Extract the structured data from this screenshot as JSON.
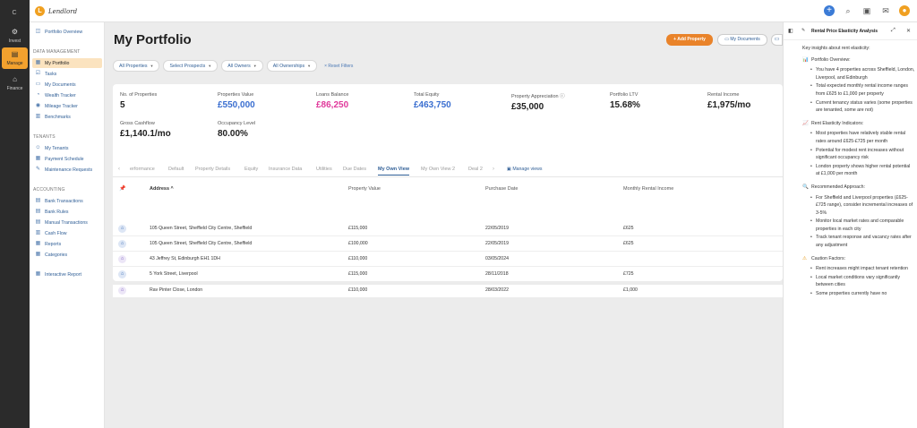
{
  "rail": {
    "collapse": "C",
    "items": [
      {
        "label": "Invest",
        "icon": "invest-icon"
      },
      {
        "label": "Manage",
        "icon": "manage-icon"
      },
      {
        "label": "Finance",
        "icon": "finance-icon"
      }
    ]
  },
  "topbar": {
    "logo_letter": "L",
    "app_name": "Lendlord",
    "icons": [
      "plus-icon",
      "search-icon",
      "camera-icon",
      "gift-icon",
      "avatar-icon"
    ]
  },
  "nav": {
    "overview": "Portfolio Overview",
    "data_heading": "DATA MANAGEMENT",
    "data_items": [
      "My Portfolio",
      "Tasks",
      "My Documents",
      "Wealth Tracker",
      "Mileage Tracker",
      "Benchmarks"
    ],
    "tenants_heading": "TENANTS",
    "tenant_items": [
      "My Tenants",
      "Payment Schedule",
      "Maintenance Requests"
    ],
    "accounting_heading": "ACCOUNTING",
    "accounting_items": [
      "Bank Transactions",
      "Bank Rules",
      "Manual Transactions",
      "Cash Flow",
      "Reports",
      "Categories"
    ],
    "interactive_report": "Interactive Report"
  },
  "main": {
    "title": "My Portfolio",
    "add_property": "+ Add Property",
    "my_documents": "My Documents",
    "filters": [
      "All Properties",
      "Select Prospects",
      "All Owners",
      "All Ownerships"
    ],
    "reset": "× Reset Filters"
  },
  "stats": [
    {
      "label": "No. of Properties",
      "value": "5",
      "color": "#1e1e1e"
    },
    {
      "label": "Properties Value",
      "value": "£550,000",
      "color": "#3b6fd0"
    },
    {
      "label": "Loans Balance",
      "value": "£86,250",
      "color": "#e0399b"
    },
    {
      "label": "Total Equity",
      "value": "£463,750",
      "color": "#3b6fd0"
    },
    {
      "label": "Property Appreciation ⓘ",
      "value": "£35,000",
      "color": "#1e1e1e"
    },
    {
      "label": "Portfolio LTV",
      "value": "15.68%",
      "color": "#1e1e1e"
    },
    {
      "label": "Rental Income",
      "value": "£1,975/mo",
      "color": "#1e1e1e"
    },
    {
      "label": "Gross Cashflow",
      "value": "£1,140.1/mo",
      "color": "#1e1e1e"
    },
    {
      "label": "Occupancy Level",
      "value": "80.00%",
      "color": "#1e1e1e"
    }
  ],
  "table": {
    "tabs": [
      "erformance",
      "Default",
      "Property Details",
      "Equity",
      "Insurance Data",
      "Utilities",
      "Due Dates",
      "My Own View",
      "My Own View 2",
      "Deal 2"
    ],
    "active_tab": "My Own View",
    "manage_views": "Manage views",
    "headers": {
      "address": "Address ^",
      "value": "Property Value",
      "date": "Purchase Date",
      "rent": "Monthly Rental Income"
    },
    "rows": [
      {
        "address": "105 Queen Street, Sheffield City Centre, Sheffield",
        "value": "£115,000",
        "date": "22/05/2019",
        "rent": "£625",
        "icon": "building"
      },
      {
        "address": "105 Queen Street, Sheffield City Centre, Sheffield",
        "value": "£100,000",
        "date": "22/05/2019",
        "rent": "£625",
        "icon": "building"
      },
      {
        "address": "43 Jeffrey St, Edinburgh EH1 1DH",
        "value": "£110,000",
        "date": "03/05/2024",
        "rent": "",
        "icon": "home"
      },
      {
        "address": "5 York Street, Liverpool",
        "value": "£115,000",
        "date": "28/11/2018",
        "rent": "£725",
        "icon": "building"
      },
      {
        "address": "Rav Pinter Close, London",
        "value": "£110,000",
        "date": "28/03/2022",
        "rent": "£1,000",
        "icon": "home"
      }
    ]
  },
  "panel": {
    "title": "Rental Price Elasticity Analysis",
    "intro": "Key insights about rent elasticity:",
    "sections": [
      {
        "icon": "📊",
        "heading": "Portfolio Overview:",
        "bullets": [
          "You have 4 properties across Sheffield, London, Liverpool, and Edinburgh",
          "Total expected monthly rental income ranges from £625 to £1,000 per property",
          "Current tenancy status varies (some properties are tenanted, some are not)"
        ]
      },
      {
        "icon": "📈",
        "heading": "Rent Elasticity Indicators:",
        "bullets": [
          "Most properties have relatively stable rental rates around £625-£725 per month",
          "Potential for modest rent increases without significant occupancy risk",
          "London property shows higher rental potential at £1,000 per month"
        ]
      },
      {
        "icon": "🔍",
        "heading": "Recommended Approach:",
        "bullets": [
          "For Sheffield and Liverpool properties (£625-£725 range), consider incremental increases of 3-5%",
          "Monitor local market rates and comparable properties in each city",
          "Track tenant response and vacancy rates after any adjustment"
        ]
      },
      {
        "icon": "⚠",
        "heading": "Caution Factors:",
        "bullets": [
          "Rent increases might impact tenant retention",
          "Local market conditions vary significantly between cities",
          "Some properties currently have no"
        ]
      }
    ]
  }
}
